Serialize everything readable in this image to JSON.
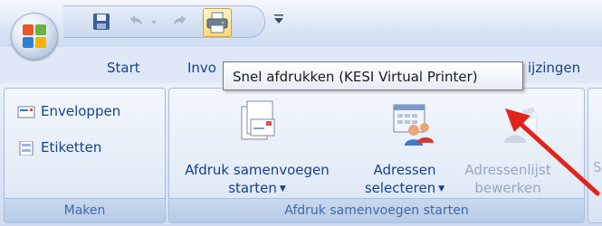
{
  "quick_access": {
    "save_icon": "save-icon",
    "undo_icon": "undo-icon",
    "redo_icon": "redo-icon",
    "print_icon": "quick-print-icon",
    "customize_icon": "customize-dropdown-icon"
  },
  "tabs": [
    {
      "label": "Start"
    },
    {
      "label": "Invo"
    },
    {
      "label": "ijzingen"
    }
  ],
  "tooltip": {
    "text": "Snel afdrukken (KESI Virtual Printer)"
  },
  "groups": {
    "maken": {
      "label": "Maken",
      "buttons": [
        {
          "label": "Enveloppen",
          "icon": "envelope-icon"
        },
        {
          "label": "Etiketten",
          "icon": "labels-icon"
        }
      ]
    },
    "afdruk": {
      "label": "Afdruk samenvoegen starten",
      "buttons": [
        {
          "line1": "Afdruk samenvoegen",
          "line2": "starten",
          "icon": "mail-merge-document-icon",
          "dropdown": true,
          "enabled": true
        },
        {
          "line1": "Adressen",
          "line2": "selecteren",
          "icon": "address-book-icon",
          "dropdown": true,
          "enabled": true
        },
        {
          "line1": "Adressenlijst",
          "line2": "bewerken",
          "icon": "edit-recipients-icon",
          "dropdown": false,
          "enabled": false
        }
      ]
    },
    "right_partial": {
      "text": "S"
    }
  },
  "colors": {
    "ribbon_text": "#15428b",
    "disabled_text": "#98a7bd",
    "arrow": "#e3231b",
    "tooltip_border": "#767676"
  }
}
